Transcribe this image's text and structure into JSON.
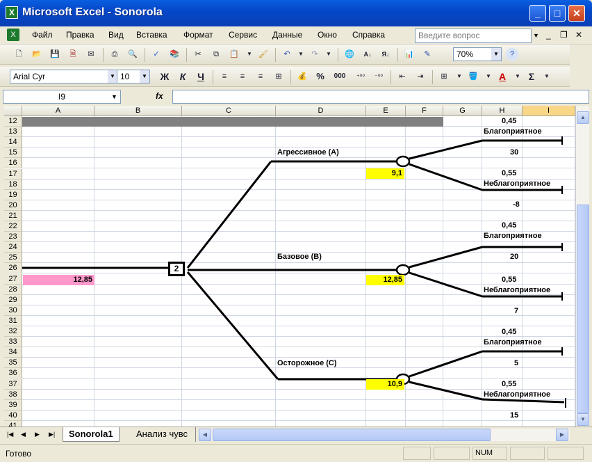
{
  "window": {
    "title": "Microsoft Excel - Sonorola"
  },
  "menu": {
    "items": [
      "Файл",
      "Правка",
      "Вид",
      "Вставка",
      "Формат",
      "Сервис",
      "Данные",
      "Окно",
      "Справка"
    ],
    "help_placeholder": "Введите вопрос"
  },
  "toolbar": {
    "zoom": "70%"
  },
  "format_toolbar": {
    "font": "Arial Cyr",
    "size": "10",
    "bold": "Ж",
    "italic": "К",
    "underline": "Ч",
    "percent": "%",
    "thousands": "000"
  },
  "formula_bar": {
    "name_box": "I9",
    "fx": "fx"
  },
  "columns": [
    "A",
    "B",
    "C",
    "D",
    "E",
    "F",
    "G",
    "H",
    "I"
  ],
  "selected_column": "I",
  "rows": [
    "12",
    "13",
    "14",
    "15",
    "16",
    "17",
    "18",
    "19",
    "20",
    "21",
    "22",
    "23",
    "24",
    "25",
    "26",
    "27",
    "28",
    "29",
    "30",
    "31",
    "32",
    "33",
    "34",
    "35",
    "36",
    "37",
    "38",
    "39",
    "40",
    "41"
  ],
  "tree": {
    "decision_node_label": "2",
    "root_value": "12,85",
    "branches": [
      {
        "name": "Агрессивное (A)",
        "ev": "9,1",
        "p_fav": "0,45",
        "fav_label": "Благоприятное",
        "fav_payoff": "30",
        "p_unfav": "0,55",
        "unfav_label": "Неблагоприятное",
        "unfav_payoff": "-8"
      },
      {
        "name": "Базовое (B)",
        "ev": "12,85",
        "p_fav": "0,45",
        "fav_label": "Благоприятное",
        "fav_payoff": "20",
        "p_unfav": "0,55",
        "unfav_label": "Неблагоприятное",
        "unfav_payoff": "7"
      },
      {
        "name": "Осторожное (C)",
        "ev": "10,9",
        "p_fav": "0,45",
        "fav_label": "Благоприятное",
        "fav_payoff": "5",
        "p_unfav": "0,55",
        "unfav_label": "Неблагоприятное",
        "unfav_payoff": "15"
      }
    ]
  },
  "sheets": {
    "active": "Sonorola1",
    "other": "Анализ чувс"
  },
  "status": {
    "text": "Готово",
    "num": "NUM"
  },
  "colors": {
    "highlight_yellow": "#ffff00",
    "highlight_pink": "#ff99cc",
    "header_gray": "#808080"
  }
}
